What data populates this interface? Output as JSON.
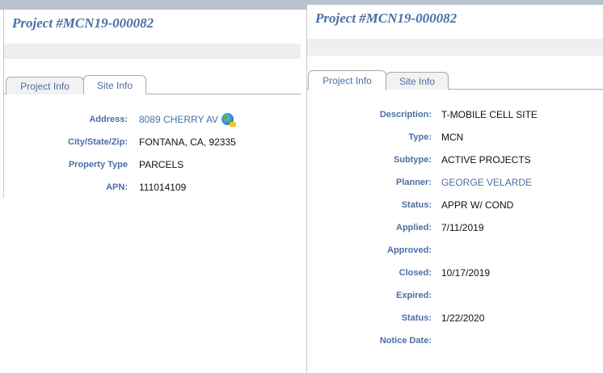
{
  "left_panel": {
    "project_title": "Project #MCN19-000082",
    "tabs": [
      {
        "label": "Project Info",
        "active": false
      },
      {
        "label": "Site Info",
        "active": true
      }
    ],
    "fields": [
      {
        "label": "Address:",
        "value": "8089 CHERRY AV",
        "link": true,
        "icon": "globe-map-icon"
      },
      {
        "label": "City/State/Zip:",
        "value": "FONTANA, CA, 92335"
      },
      {
        "label": "Property Type",
        "value": "PARCELS"
      },
      {
        "label": "APN:",
        "value": "111014109"
      }
    ]
  },
  "right_panel": {
    "project_title": "Project #MCN19-000082",
    "tabs": [
      {
        "label": "Project Info",
        "active": true
      },
      {
        "label": "Site Info",
        "active": false
      }
    ],
    "fields": [
      {
        "label": "Description:",
        "value": "T-MOBILE CELL SITE"
      },
      {
        "label": "Type:",
        "value": "MCN"
      },
      {
        "label": "Subtype:",
        "value": "ACTIVE PROJECTS"
      },
      {
        "label": "Planner:",
        "value": "GEORGE VELARDE",
        "link": true
      },
      {
        "label": "Status:",
        "value": "APPR W/ COND"
      },
      {
        "label": "Applied:",
        "value": "7/11/2019"
      },
      {
        "label": "Approved:",
        "value": ""
      },
      {
        "label": "Closed:",
        "value": "10/17/2019"
      },
      {
        "label": "Expired:",
        "value": ""
      },
      {
        "label": "Status:",
        "value": "1/22/2020"
      },
      {
        "label": "Notice Date:",
        "value": ""
      }
    ]
  },
  "colors": {
    "accent": "#4a6fa5",
    "value_text": "#111111",
    "grey_bar": "#efefef",
    "background_strip": "#b8c2cf"
  }
}
